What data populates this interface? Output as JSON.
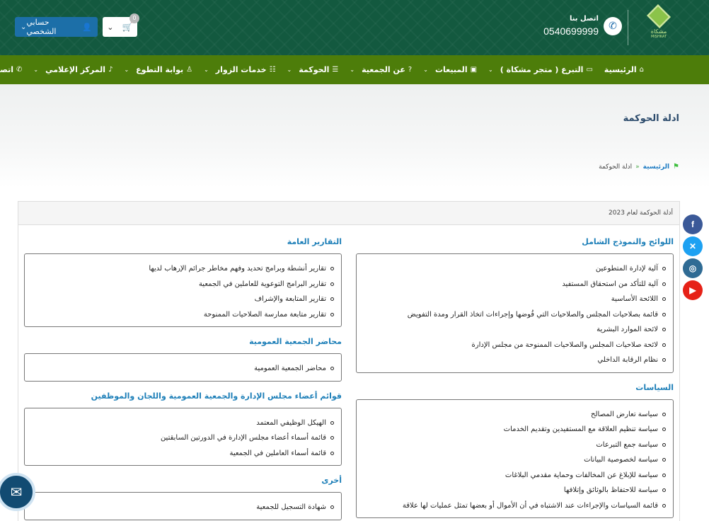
{
  "header": {
    "contact_label": "اتصل بنا",
    "contact_phone": "0540699999",
    "logo_text": "مشكاة",
    "logo_sub": "MISHKAT",
    "account_label": "حسابي الشخصي",
    "cart_count": "0",
    "colors": {
      "top_bg": "#13593f",
      "nav_bg": "#4d7d0a",
      "account_btn": "#1c6fa8"
    }
  },
  "nav": {
    "items": [
      {
        "label": "الرئيسية",
        "icon": "home-icon",
        "glyph": "⌂",
        "dropdown": false
      },
      {
        "label": "التبرع ( متجر مشكاة )",
        "icon": "donate-card-icon",
        "glyph": "▭",
        "dropdown": true
      },
      {
        "label": "المبيعات",
        "icon": "money-icon",
        "glyph": "▣",
        "dropdown": true
      },
      {
        "label": "عن الجمعية",
        "icon": "question-icon",
        "glyph": "?",
        "dropdown": true
      },
      {
        "label": "الحوكمة",
        "icon": "list-icon",
        "glyph": "☰",
        "dropdown": true
      },
      {
        "label": "خدمات الزوار",
        "icon": "server-icon",
        "glyph": "☷",
        "dropdown": true
      },
      {
        "label": "بوابة التطوع",
        "icon": "person-icon",
        "glyph": "♙",
        "dropdown": true
      },
      {
        "label": "المركز الإعلامي",
        "icon": "mic-icon",
        "glyph": "♪",
        "dropdown": true
      },
      {
        "label": "اتصل بنا",
        "icon": "phone-icon",
        "glyph": "✆",
        "dropdown": true
      }
    ]
  },
  "page": {
    "title": "ادلة الحوكمة",
    "breadcrumb_home": "الرئيسية",
    "breadcrumb_sep": "»",
    "breadcrumb_current": "ادلة الحوكمة"
  },
  "panel": {
    "header": "أدلة الحوكمة لعام 2023",
    "right_sections": [
      {
        "title": "اللوائح والنموذج الشامل",
        "items": [
          "آلية لإدارة المتطوعين",
          "آلية للتأكد من استحقاق المستفيد",
          "اللائحة الأساسية",
          "قائمة بصلاحيات المجلس والصلاحيات التي فُوضها وإجراءات اتخاذ القرار ومدة التفويض",
          "لائحة الموارد البشرية",
          "لائحة صلاحيات المجلس والصلاحيات الممنوحة من مجلس الإدارة",
          "نظام الرقابة الداخلي"
        ]
      },
      {
        "title": "السياسات",
        "items": [
          "سياسة تعارض المصالح",
          "سياسة تنظيم العلاقة مع المستفيدين وتقديم الخدمات",
          "سياسة جمع التبرعات",
          "سياسة لخصوصية البيانات",
          "سياسة للإبلاغ عن المخالفات وحماية مقدمي البلاغات",
          "سياسة للاحتفاظ بالوثائق وإتلافها",
          "قائمة السياسات والإجراءات عند الاشتباه في أن الأموال أو بعضها تمثل عمليات لها علاقة"
        ]
      }
    ],
    "left_sections": [
      {
        "title": "التقارير العامة",
        "items": [
          "تقارير أنشطة وبرامج تحديد وفهم مخاطر جرائم الإرهاب لديها",
          "تقارير البرامج التوعوية للعاملين في الجمعية",
          "تقارير المتابعة والإشراف",
          "تقارير متابعة ممارسة الصلاحيات الممنوحة"
        ]
      },
      {
        "title": "محاضر الجمعية العمومية",
        "items": [
          "محاضر الجمعية العمومية"
        ]
      },
      {
        "title": "قوائم أعضاء مجلس الإدارة والجمعية العمومية واللجان والموظفين",
        "items": [
          "الهيكل الوظيفي المعتمد",
          "قائمة أسماء أعضاء مجلس الإدارة في الدورتين السابقتين",
          "قائمة أسماء العاملين في الجمعية"
        ]
      },
      {
        "title": "أخرى",
        "items": [
          "شهادة التسجيل للجمعية"
        ]
      }
    ]
  },
  "social": [
    {
      "name": "facebook",
      "glyph": "f",
      "color": "#3b5998"
    },
    {
      "name": "x-twitter",
      "glyph": "✕",
      "color": "#1da1f2"
    },
    {
      "name": "instagram",
      "glyph": "◎",
      "color": "#2f6b94"
    },
    {
      "name": "youtube",
      "glyph": "▶",
      "color": "#e62117"
    }
  ]
}
